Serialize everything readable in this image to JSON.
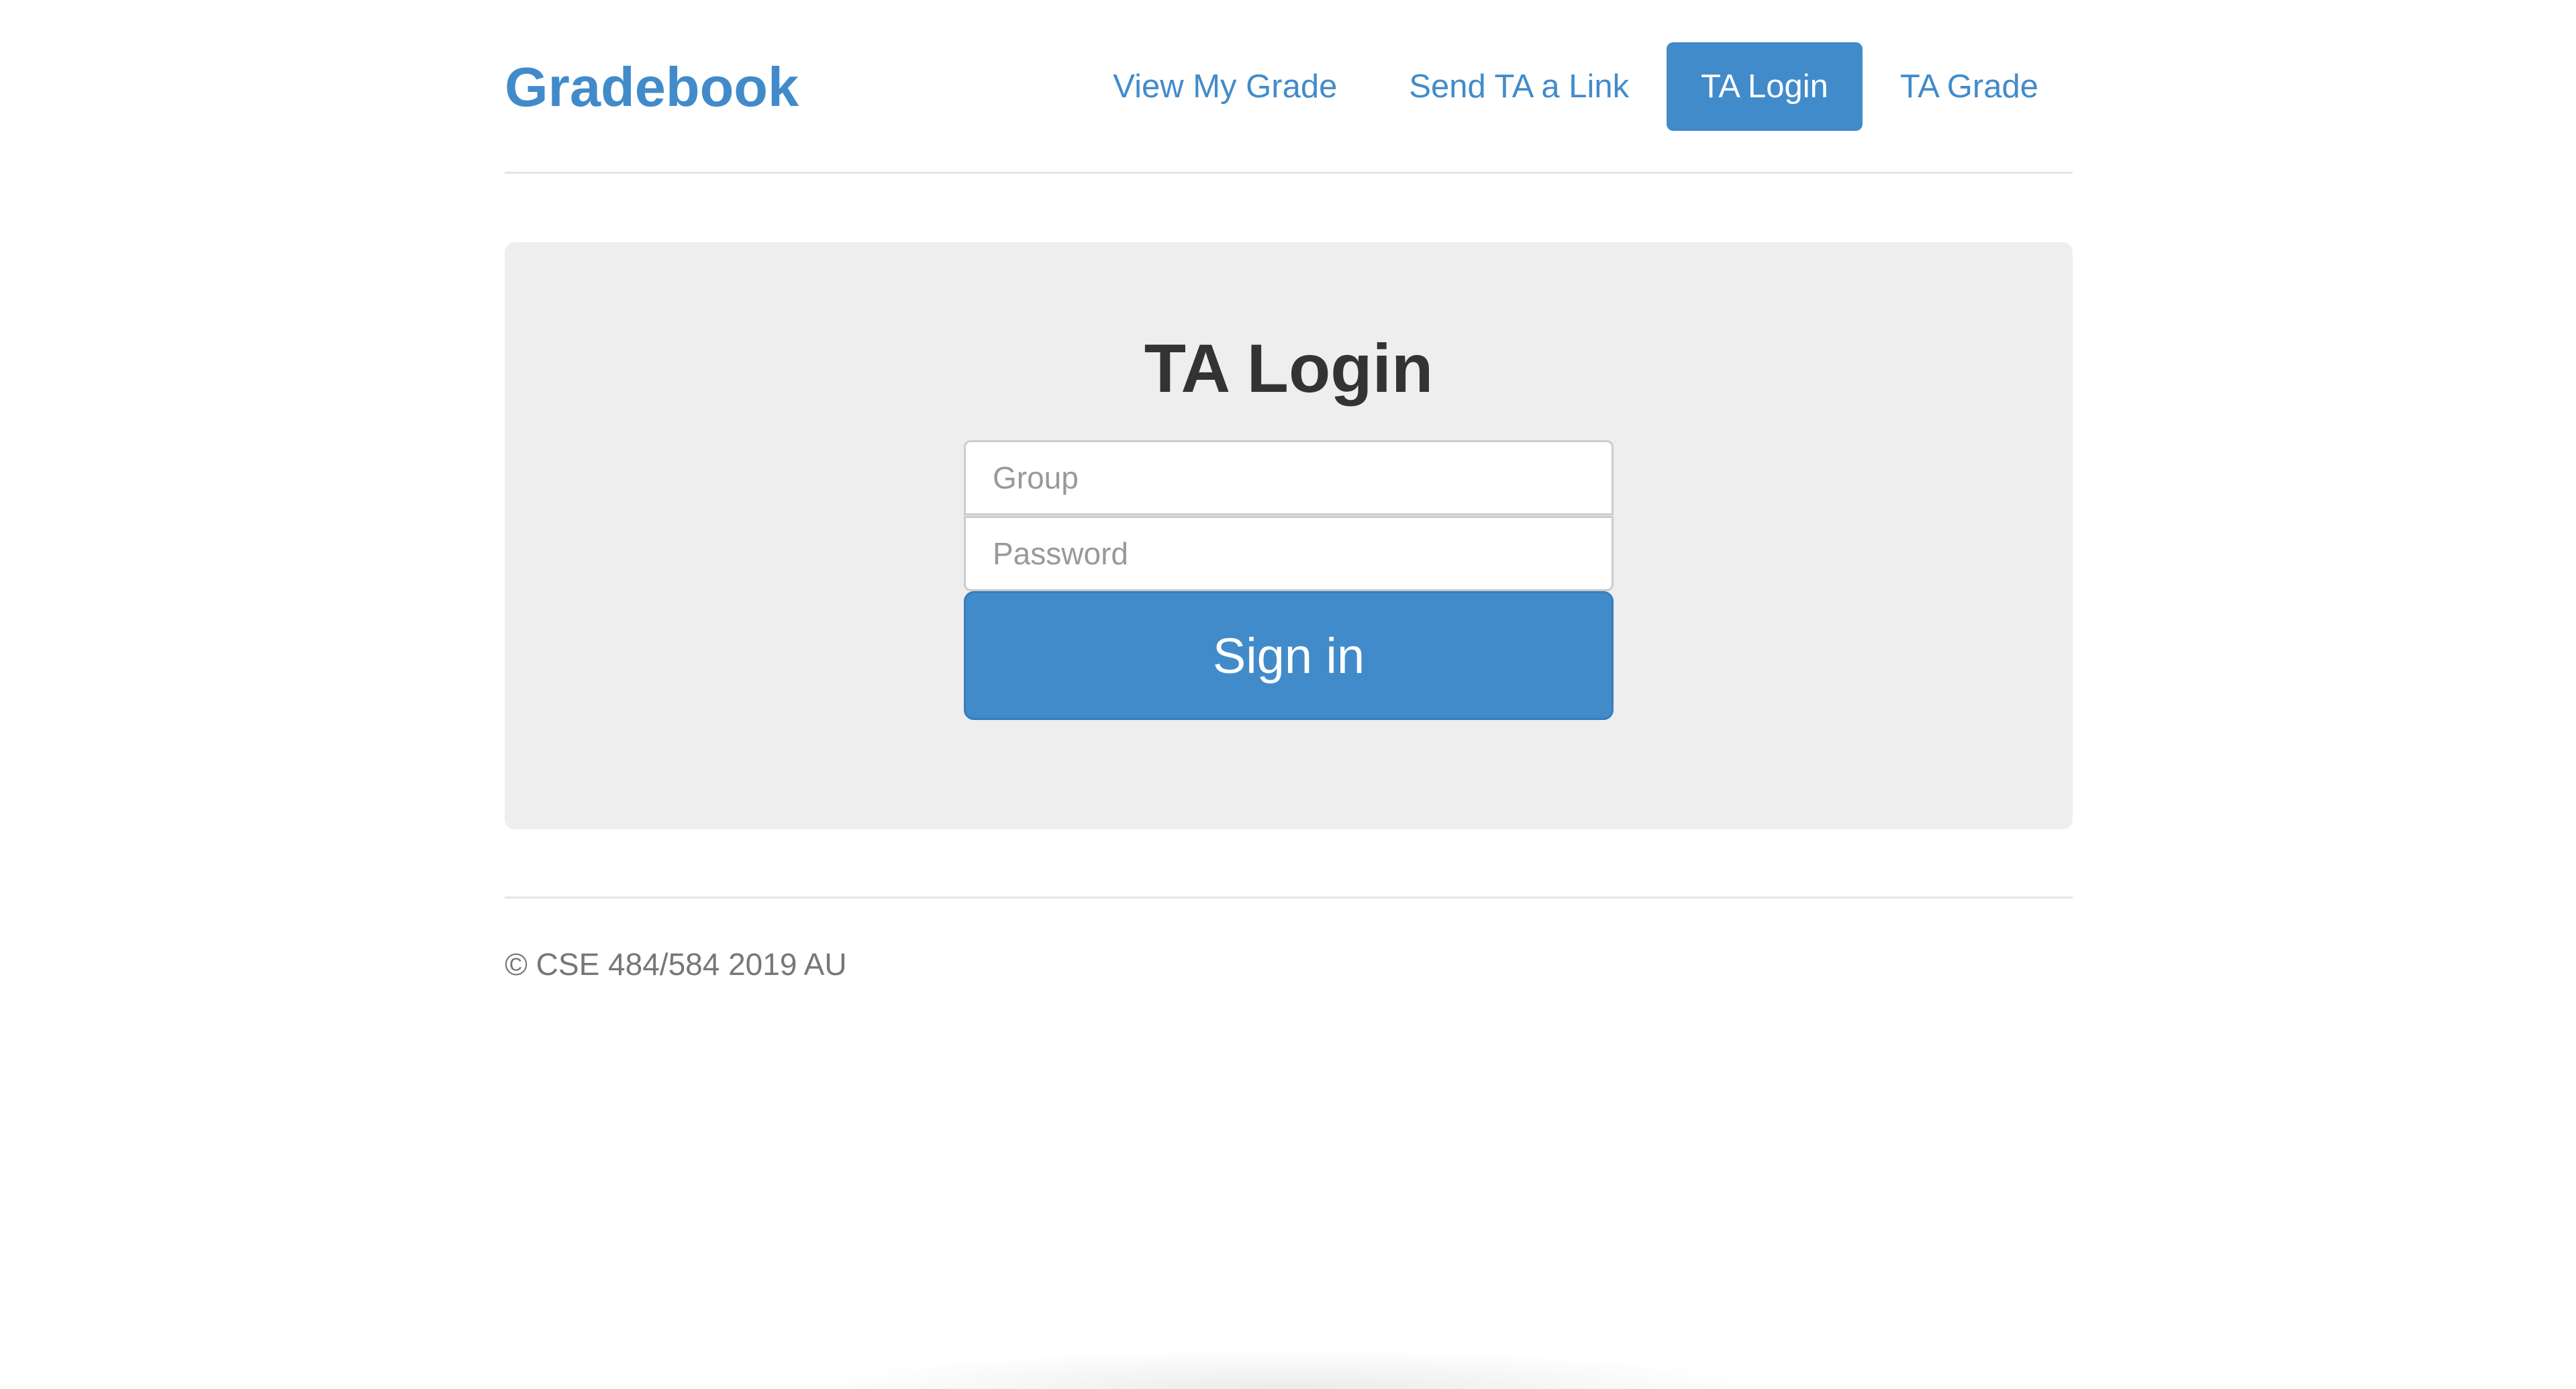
{
  "header": {
    "brand": "Gradebook",
    "nav": [
      {
        "label": "View My Grade",
        "active": false
      },
      {
        "label": "Send TA a Link",
        "active": false
      },
      {
        "label": "TA Login",
        "active": true
      },
      {
        "label": "TA Grade",
        "active": false
      }
    ]
  },
  "login": {
    "title": "TA Login",
    "group_placeholder": "Group",
    "group_value": "",
    "password_placeholder": "Password",
    "password_value": "",
    "signin_label": "Sign in"
  },
  "footer": {
    "text": "© CSE 484/584 2019 AU"
  },
  "colors": {
    "accent": "#428bca",
    "jumbotron_bg": "#eeeeee",
    "title_text": "#333333",
    "footer_text": "#777777"
  }
}
